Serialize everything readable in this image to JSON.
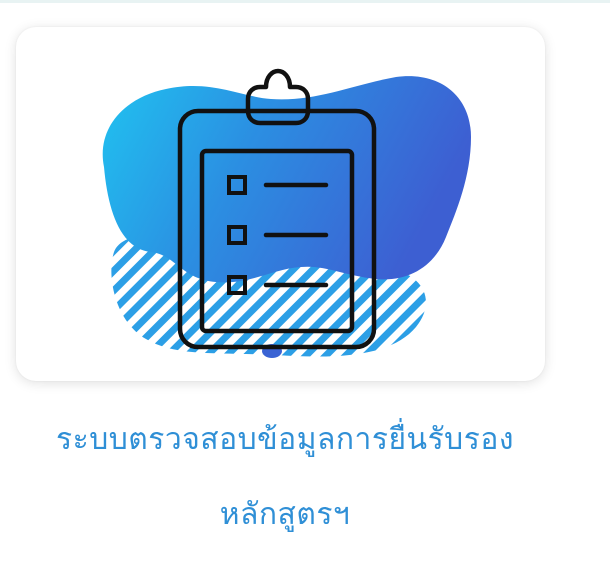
{
  "card": {
    "title_line1": "ระบบตรวจสอบข้อมูลการยื่นรับรอง",
    "title_line2": "หลักสูตรฯ",
    "icon": "clipboard-checklist-icon"
  },
  "colors": {
    "accent_text": "#2f8fd6",
    "blob_light": "#2ab0ea",
    "blob_dark": "#3a63d4",
    "outline": "#111111"
  }
}
